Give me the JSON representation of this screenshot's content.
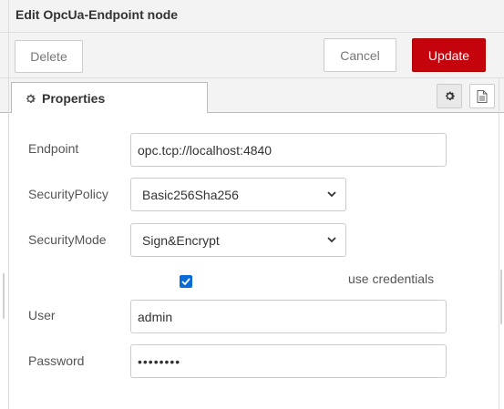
{
  "tray": {
    "title": "Edit OpcUa-Endpoint node",
    "delete_label": "Delete",
    "cancel_label": "Cancel",
    "update_label": "Update",
    "accent": "#c4030d"
  },
  "tabs": {
    "properties_label": "Properties",
    "properties_icon": "gear-icon",
    "right_icons": [
      "gear-icon",
      "document-icon"
    ]
  },
  "form": {
    "endpoint_label": "Endpoint",
    "endpoint_value": "opc.tcp://localhost:4840",
    "security_policy_label": "SecurityPolicy",
    "security_policy_value": "Basic256Sha256",
    "security_mode_label": "SecurityMode",
    "security_mode_value": "Sign&Encrypt",
    "use_credentials_label": "use credentials",
    "use_credentials_checked": true,
    "user_label": "User",
    "user_value": "admin",
    "password_label": "Password",
    "password_value": "••••••••"
  }
}
